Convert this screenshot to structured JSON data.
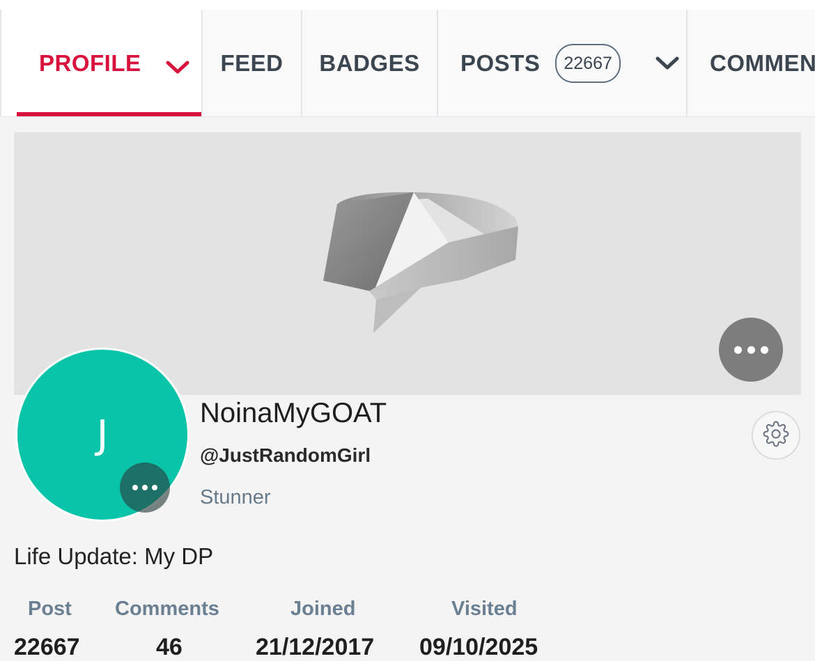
{
  "tabs": {
    "profile": "PROFILE",
    "feed": "FEED",
    "badges": "BADGES",
    "posts": "POSTS",
    "posts_count": "22667",
    "comments": "COMMEN"
  },
  "profile": {
    "avatar_initial": "J",
    "display_name": "NoinaMyGOAT",
    "handle": "@JustRandomGirl",
    "rank": "Stunner",
    "bio": "Life Update: My DP"
  },
  "stats": {
    "post_label": "Post",
    "post_value": "22667",
    "comments_label": "Comments",
    "comments_value": "46",
    "joined_label": "Joined",
    "joined_value": "21/12/2017",
    "visited_label": "Visited",
    "visited_value": "09/10/2025"
  },
  "colors": {
    "accent": "#d8123c",
    "avatar_bg": "#0ac4aa",
    "page_bg": "#f4f4f4"
  }
}
